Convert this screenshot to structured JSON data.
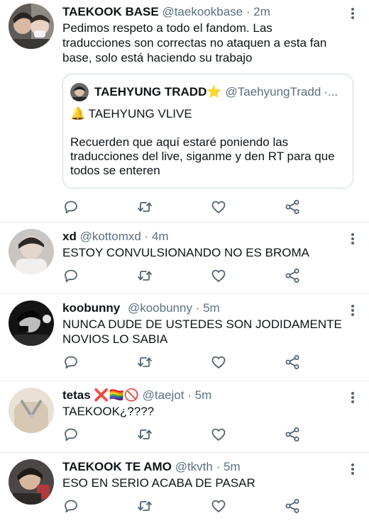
{
  "tweets": [
    {
      "name": "TAEKOOK BASE",
      "handle": "@taekookbase",
      "separator": "·",
      "time": "2m",
      "text": "Pedimos respeto a todo el fandom. Las traducciones son correctas no ataquen a esta fan base, solo está haciendo su trabajo",
      "quote": {
        "name": "TAEHYUNG TRADD⭐",
        "handle": "@TaehyungTradd",
        "ellipsis": "·...",
        "lines": [
          "🔔 TAEHYUNG VLIVE",
          "",
          "Recuerden que aquí estaré poniendo las traducciones del live, siganme y den RT para que todos se enteren"
        ]
      }
    },
    {
      "name": "xd",
      "handle": "@kottomxd",
      "separator": "·",
      "time": "4m",
      "text": "ESTOY CONVULSIONANDO NO ES BROMA"
    },
    {
      "name": "koobunny",
      "handle": "@koobunny",
      "separator": "·",
      "time": "5m",
      "text": "NUNCA DUDE DE USTEDES SON JODIDAMENTE NOVIOS LO SABIA"
    },
    {
      "name": "tetas ❌🏳️‍🌈🚫",
      "handle": "@taejot",
      "separator": "·",
      "time": "5m",
      "text": "TAEKOOK¿????"
    },
    {
      "name": "TAEKOOK TE AMO",
      "handle": "@tkvth",
      "separator": "·",
      "time": "5m",
      "text": "ESO EN SERIO ACABA DE PASAR"
    }
  ],
  "colors": {
    "text": "#0f1419",
    "secondary": "#5b7083",
    "icon": "#536471",
    "divider": "#e6ecf0",
    "quote_border": "#cfd9de"
  },
  "icons": [
    "reply-icon",
    "retweet-icon",
    "like-icon",
    "share-icon",
    "more-options-icon"
  ]
}
